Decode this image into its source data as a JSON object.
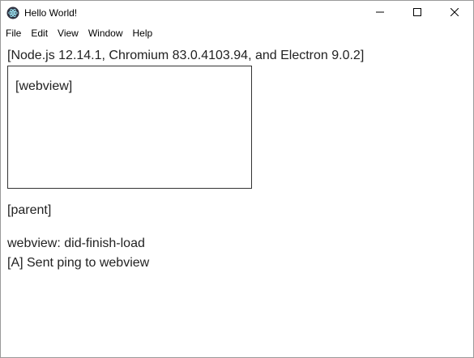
{
  "window": {
    "title": "Hello World!",
    "app_icon": "electron-logo-icon",
    "controls": [
      "minimize-icon",
      "maximize-icon",
      "close-icon"
    ]
  },
  "menu": {
    "items": [
      "File",
      "Edit",
      "View",
      "Window",
      "Help"
    ]
  },
  "main": {
    "versions_text": "[Node.js 12.14.1, Chromium 83.0.4103.94, and Electron 9.0.2]",
    "webview_label": "[webview]",
    "parent_label": "[parent]",
    "log": [
      "webview: did-finish-load",
      "[A] Sent ping to webview"
    ]
  },
  "colors": {
    "text": "#222222",
    "border": "#333333",
    "background": "#ffffff"
  }
}
